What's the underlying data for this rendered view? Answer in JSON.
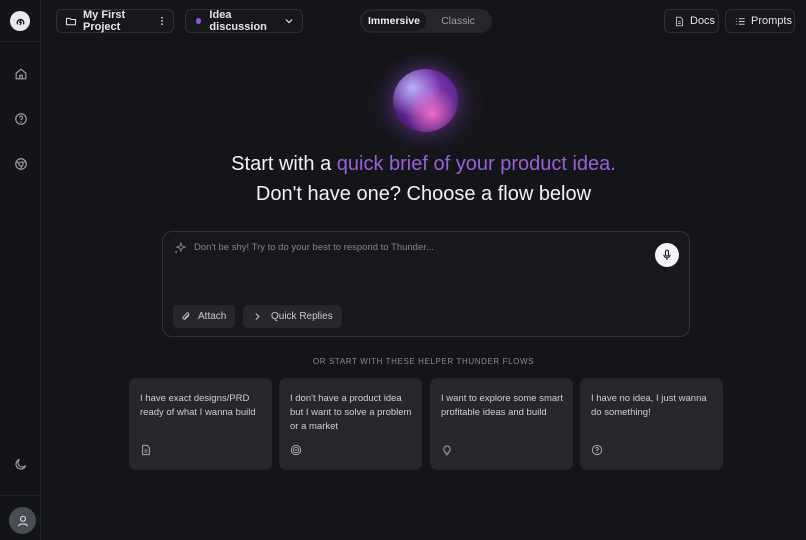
{
  "header": {
    "project_label": "My First Project",
    "session_label": "Idea discussion",
    "session_dot_color": "#8e59d6",
    "mode_toggle": {
      "options": [
        "Immersive",
        "Classic"
      ],
      "selected": "Immersive"
    },
    "docs_label": "Docs",
    "prompts_label": "Prompts"
  },
  "sidebar": {
    "icons": [
      "thunder-logo-icon",
      "home-icon",
      "help-icon",
      "chrome-icon",
      "moon-icon",
      "user-icon"
    ]
  },
  "hero": {
    "line1_prefix": "Start with a ",
    "line1_accent": "quick brief of your product idea.",
    "line2": "Don't have one? Choose a flow below",
    "accent_color": "#9b5fd9"
  },
  "composer": {
    "placeholder": "Don't be shy! Try to do your best to respond to Thunder...",
    "attach_label": "Attach",
    "quick_replies_label": "Quick Replies"
  },
  "helper": {
    "label": "OR START WITH THESE HELPER THUNDER FLOWS",
    "cards": [
      {
        "text": "I have exact designs/PRD ready of what I wanna build",
        "icon": "document-icon"
      },
      {
        "text": "I don't have a product idea but I want to solve a problem or a market",
        "icon": "target-icon"
      },
      {
        "text": "I want to explore some smart profitable ideas and build",
        "icon": "lightbulb-icon"
      },
      {
        "text": "I have no idea, I just wanna do something!",
        "icon": "question-circle-icon"
      }
    ]
  }
}
